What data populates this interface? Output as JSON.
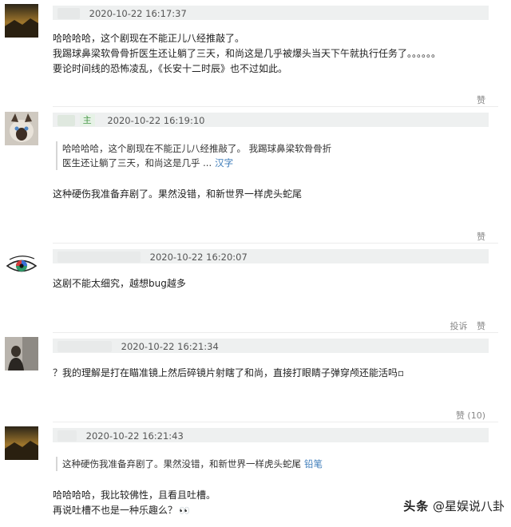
{
  "comments": [
    {
      "time": "2020-10-22 16:17:37",
      "lines": [
        "哈哈哈哈，这个剧现在不能正儿八经推敲了。",
        "我踢球鼻梁软骨骨折医生还让躺了三天，和尚这是几乎被爆头当天下午就执行任务了。。。。。。",
        "要论时间线的恐怖凌乱，《长安十二时辰》也不过如此。"
      ],
      "actions": [
        "赞"
      ]
    },
    {
      "time": "2020-10-22 16:19:10",
      "user_tag": "主",
      "quote": {
        "line1": "哈哈哈哈，这个剧现在不能正儿八经推敲了。 我踢球鼻梁软骨骨折",
        "line2": "医生还让躺了三天，和尚这是几乎 ...",
        "link": "汉字"
      },
      "lines": [
        "这种硬伤我准备弃剧了。果然没错，和新世界一样虎头蛇尾"
      ],
      "actions": [
        "赞"
      ]
    },
    {
      "time": "2020-10-22 16:20:07",
      "lines": [
        "这剧不能太细究，越想bug越多"
      ],
      "actions": [
        "投诉",
        "赞"
      ]
    },
    {
      "time": "2020-10-22 16:21:34",
      "lines": [
        "？我的理解是打在瞄准镜上然后碎镜片射瞎了和尚，直接打眼睛子弹穿颅还能活吗▫"
      ],
      "actions": [
        "赞 (10)"
      ]
    },
    {
      "time": "2020-10-22 16:21:43",
      "quote": {
        "line1": "这种硬伤我准备弃剧了。果然没错，和新世界一样虎头蛇尾",
        "link": "铅笔"
      },
      "lines": [
        "哈哈哈哈，我比较佛性，且看且吐槽。",
        "再说吐槽不也是一种乐趣么？"
      ]
    }
  ],
  "watermark": {
    "logo": "头条",
    "account": "@星娱说八卦"
  }
}
